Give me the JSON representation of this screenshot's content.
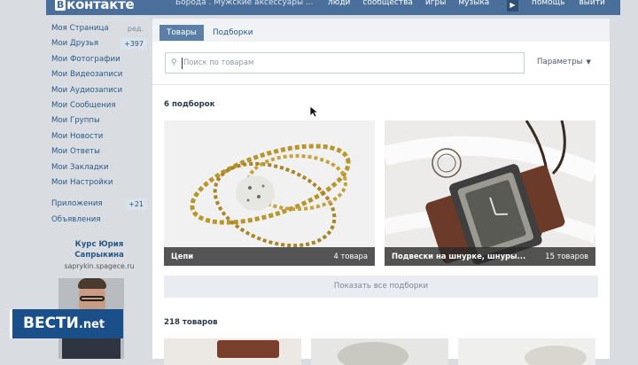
{
  "topbar": {
    "logo_badge": "В",
    "logo_text": "контакте",
    "breadcrumb": "Борода . Мужские аксессуары ...",
    "nav": [
      "люди",
      "сообщества",
      "игры",
      "музыка"
    ],
    "right": [
      "помощь",
      "выйти"
    ]
  },
  "leftmenu": {
    "items": [
      {
        "label": "Моя Страница",
        "extra": "ред."
      },
      {
        "label": "Мои Друзья",
        "badge": "+397"
      },
      {
        "label": "Мои Фотографии"
      },
      {
        "label": "Мои Видеозаписи"
      },
      {
        "label": "Мои Аудиозаписи"
      },
      {
        "label": "Мои Сообщения"
      },
      {
        "label": "Мои Группы"
      },
      {
        "label": "Мои Новости"
      },
      {
        "label": "Мои Ответы"
      },
      {
        "label": "Мои Закладки"
      },
      {
        "label": "Мои Настройки"
      }
    ],
    "apps": [
      {
        "label": "Приложения",
        "badge": "+21"
      },
      {
        "label": "Объявления"
      }
    ]
  },
  "promo": {
    "title": "Курс Юрия Сапрыкина",
    "link": "saprykin.spagece.ru"
  },
  "main": {
    "tabs": [
      "Товары",
      "Подборки"
    ],
    "search_placeholder": "Поиск по товарам",
    "params_label": "Параметры",
    "collections_title": "6 подборок",
    "collections": [
      {
        "name": "Цепи",
        "count": "4 товара"
      },
      {
        "name": "Подвески на шнурке, шнуры...",
        "count": "15 товаров"
      }
    ],
    "show_all": "Показать все подборки",
    "goods_title": "218 товаров"
  },
  "overlay": {
    "channel": "ВЕСТИ",
    "suffix": ".net"
  },
  "colors": {
    "vk_blue": "#4a6f9a",
    "link": "#2a5885",
    "tab_active": "#5b7fa6",
    "tv_blue": "#1a4f8a"
  },
  "icons": {
    "search": "search-icon",
    "dropdown": "chevron-down-icon",
    "nav_next": "chevron-right-icon",
    "cursor": "mouse-cursor-icon"
  }
}
